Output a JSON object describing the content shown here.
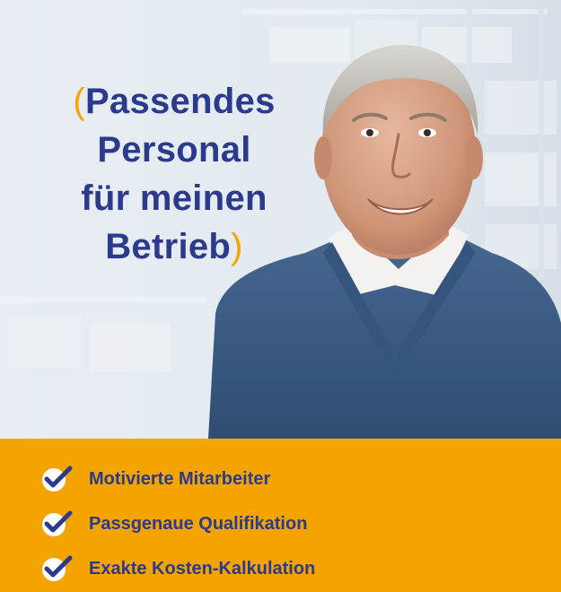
{
  "headline": {
    "open_paren": "(",
    "line1": "Passendes",
    "line2": "Personal",
    "line3": "für meinen",
    "line4": "Betrieb",
    "close_paren": ")"
  },
  "benefits": [
    {
      "label": "Motivierte Mitarbeiter"
    },
    {
      "label": "Passgenaue Qualifikation"
    },
    {
      "label": "Exakte Kosten-Kalkulation"
    }
  ],
  "icons": {
    "check": "checkmark-icon"
  },
  "colors": {
    "brand_blue": "#2b3a8c",
    "accent_orange": "#f3a400",
    "check_circle": "#ffffff"
  }
}
